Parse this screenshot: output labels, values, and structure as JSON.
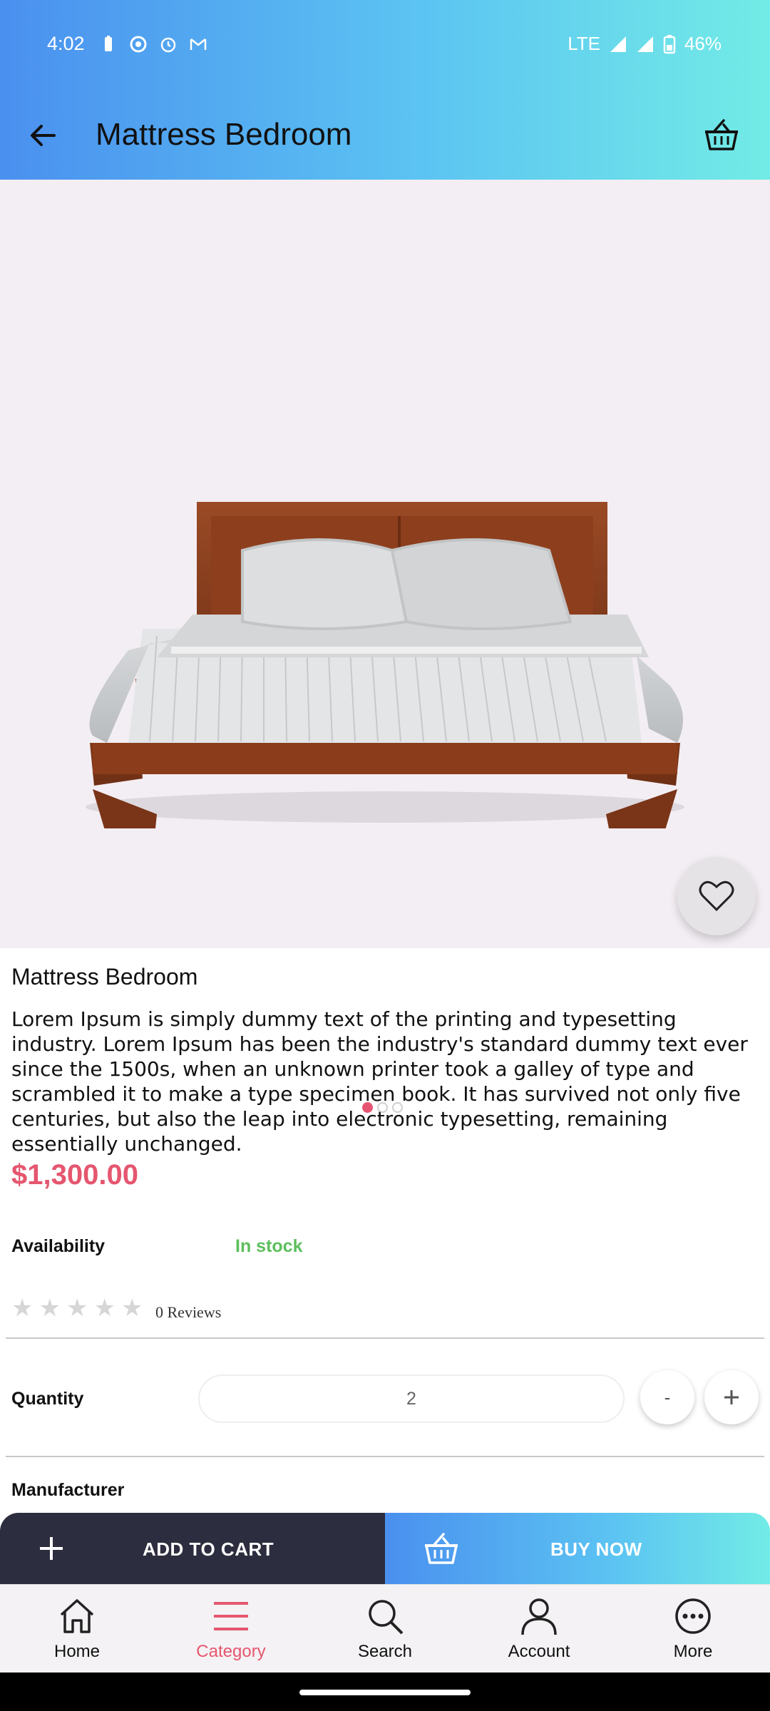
{
  "status_bar": {
    "time": "4:02",
    "network": "LTE",
    "battery": "46%"
  },
  "header": {
    "title": "Mattress Bedroom",
    "back_icon": "arrow-left-icon",
    "cart_icon": "basket-icon"
  },
  "gallery": {
    "image": "bed-photo",
    "dot_count": 3,
    "active_index": 0,
    "favorite_icon": "heart-outline-icon"
  },
  "product": {
    "name": "Mattress Bedroom",
    "description": "Lorem Ipsum is simply dummy text of the printing and typesetting industry. Lorem Ipsum has been the industry's standard dummy text ever since the 1500s, when an unknown printer took a galley of type and scrambled it to make a type specimen book. It has survived not only five centuries, but also the leap into electronic typesetting, remaining essentially unchanged.",
    "price": "$1,300.00",
    "availability_label": "Availability",
    "availability_value": "In stock",
    "rating": 0,
    "rating_max": 5,
    "reviews": "0 Reviews",
    "quantity_label": "Quantity",
    "quantity_value": "2",
    "minus_label": "-",
    "manufacturer_label": "Manufacturer"
  },
  "actions": {
    "add_to_cart": "ADD TO CART",
    "buy_now": "BUY NOW"
  },
  "bottom_nav": {
    "items": [
      {
        "label": "Home",
        "icon": "home-icon"
      },
      {
        "label": "Category",
        "icon": "menu-icon"
      },
      {
        "label": "Search",
        "icon": "search-icon"
      },
      {
        "label": "Account",
        "icon": "user-icon"
      },
      {
        "label": "More",
        "icon": "more-icon"
      }
    ],
    "active_index": 1
  },
  "colors": {
    "accent": "#e5566f",
    "in_stock": "#5cbf5c",
    "cart_button": "#2c2d3e",
    "gradient_start": "#4a90ef",
    "gradient_end": "#72ebe6"
  }
}
